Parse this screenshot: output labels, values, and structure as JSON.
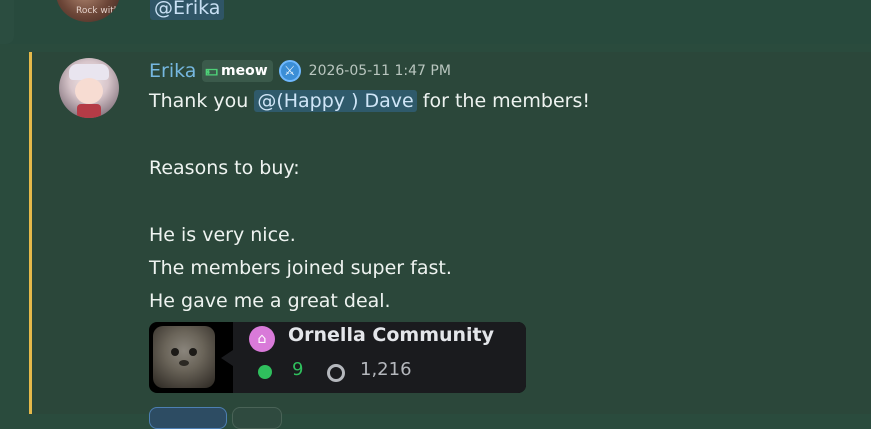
{
  "previous_message": {
    "avatar_caption": "Rock with",
    "mention": "@Erika"
  },
  "message": {
    "username": "Erika",
    "role": {
      "icon": "money-bill-icon",
      "label": "meow"
    },
    "badge_icon": "crossed-swords-icon",
    "timestamp": "2026-05-11 1:47 PM",
    "line1_prefix": "Thank you ",
    "line1_mention": "@(Happy ) Dave",
    "line1_suffix": " for the members!",
    "line2": "Reasons to buy:",
    "line3": "He is very nice.",
    "line4": "The members joined super fast.",
    "line5": "He gave me a great deal."
  },
  "embed": {
    "server_name": "Ornella Community",
    "online_count": "9",
    "member_count": "1,216",
    "server_icon": "home-icon"
  },
  "colors": {
    "highlight_bar": "#e5b94a",
    "mention_bg": "#2f5a6b",
    "username": "#76b8e0",
    "online": "#2fbf5d"
  }
}
